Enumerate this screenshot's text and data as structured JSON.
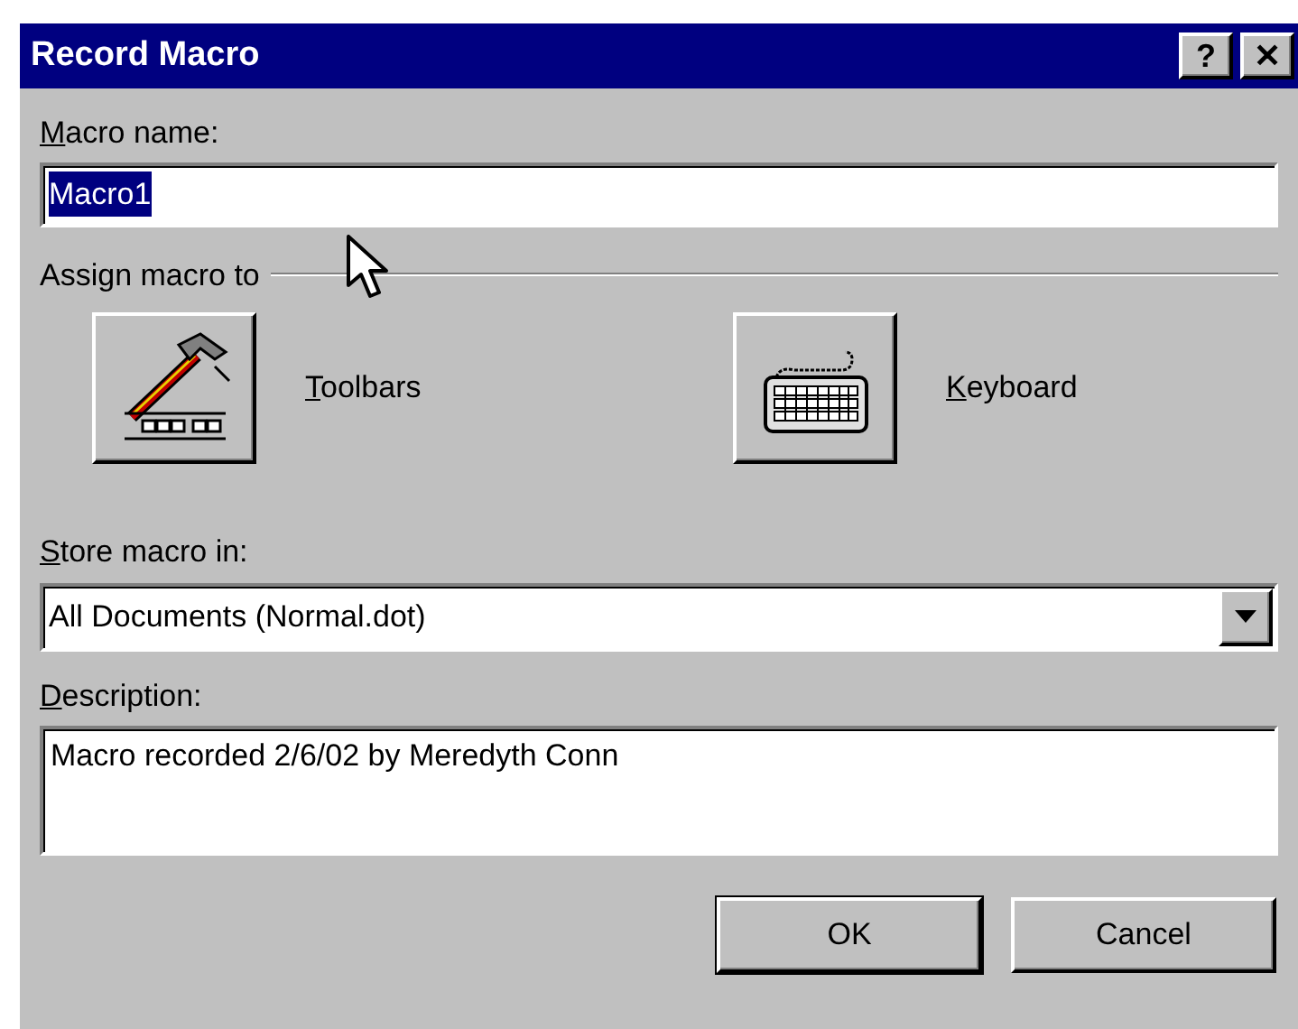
{
  "window": {
    "title": "Record Macro",
    "buttons": [
      {
        "label": "?"
      },
      {
        "label": "✕"
      }
    ]
  },
  "macro_name": {
    "label": "Macro name:",
    "mnemonic": true,
    "value": "Macro1",
    "selected": true
  },
  "assign": {
    "label": "Assign macro to",
    "options": [
      {
        "kind": "toolbars",
        "label": "Toolbars",
        "mnemonic": true
      },
      {
        "kind": "keyboard",
        "label": "Keyboard",
        "mnemonic": true
      }
    ]
  },
  "store": {
    "label": "Store macro in:",
    "mnemonic": true,
    "value": "All Documents (Normal.dot)"
  },
  "description": {
    "label": "Description:",
    "mnemonic": true,
    "value": "Macro recorded 2/6/02 by Meredyth Conn"
  },
  "buttons": [
    {
      "label": "OK",
      "default": true
    },
    {
      "label": "Cancel",
      "default": false
    }
  ]
}
